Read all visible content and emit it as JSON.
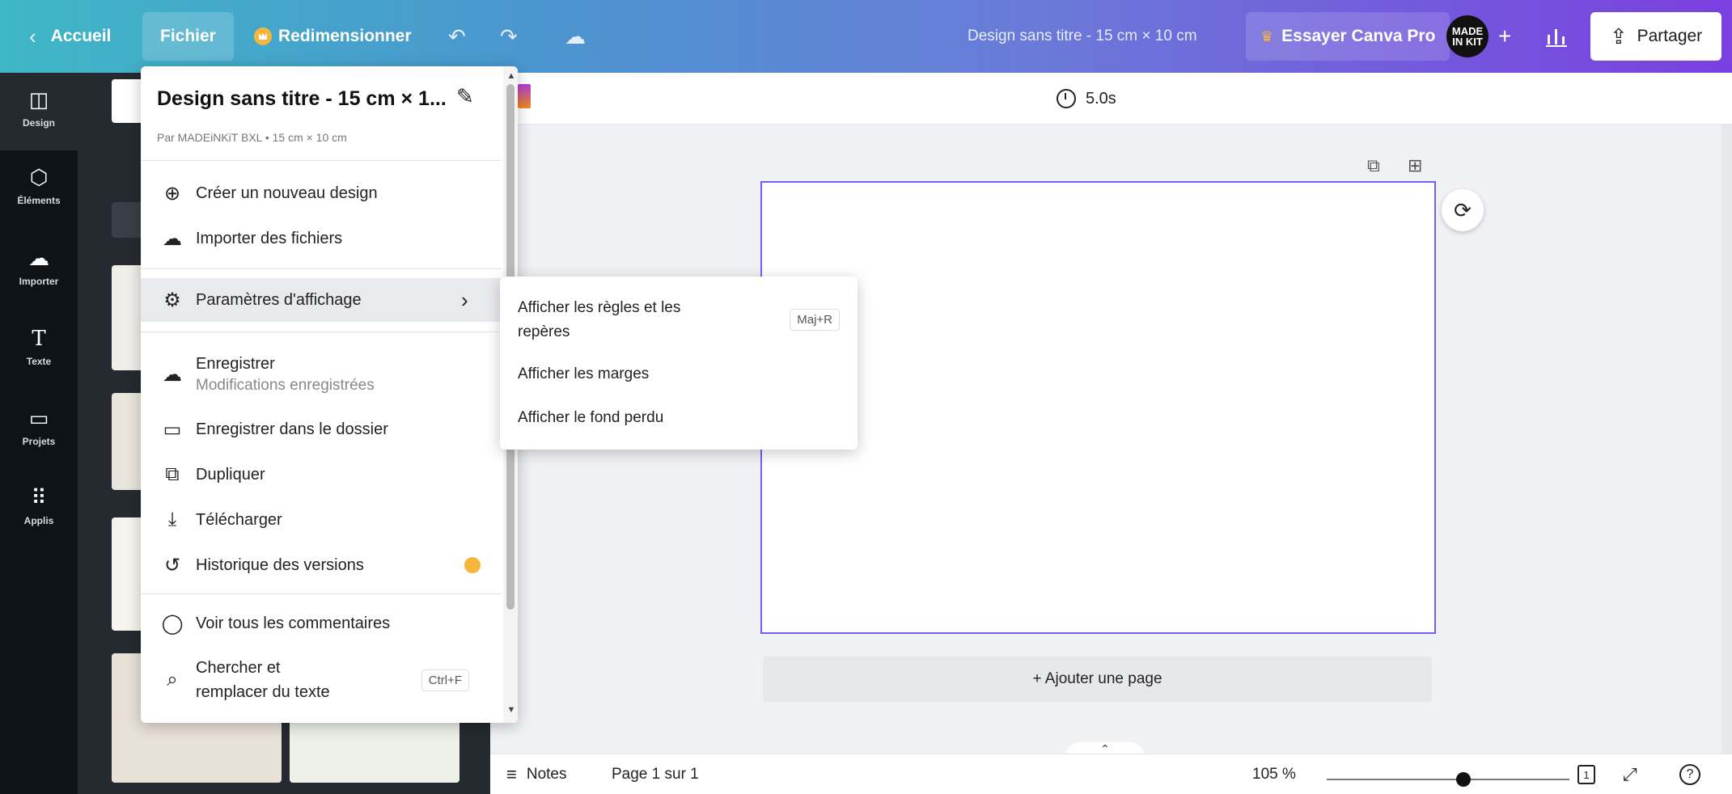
{
  "topbar": {
    "back_label": "Accueil",
    "file_label": "Fichier",
    "resize_label": "Redimensionner",
    "design_title": "Design sans titre - 15 cm × 10 cm",
    "try_pro_label": "Essayer Canva Pro",
    "avatar_text": "MADE IN KIT",
    "plus": "+",
    "share_label": "Partager"
  },
  "rail": {
    "items": [
      {
        "label": "Design"
      },
      {
        "label": "Éléments"
      },
      {
        "label": "Importer"
      },
      {
        "label": "Texte"
      },
      {
        "label": "Projets"
      },
      {
        "label": "Applis"
      }
    ]
  },
  "toolbar2": {
    "duration": "5.0s"
  },
  "menu": {
    "title": "Design sans titre - 15 cm × 1...",
    "subtitle": "Par MADEiNKiT BXL • 15 cm × 10 cm",
    "items": [
      {
        "label": "Créer un nouveau design"
      },
      {
        "label": "Importer des fichiers"
      },
      {
        "label": "Paramètres d'affichage"
      },
      {
        "label": "Enregistrer",
        "sub": "Modifications enregistrées"
      },
      {
        "label": "Enregistrer dans le dossier"
      },
      {
        "label": "Dupliquer"
      },
      {
        "label": "Télécharger"
      },
      {
        "label": "Historique des versions"
      },
      {
        "label": "Voir tous les commentaires"
      },
      {
        "label": "Chercher et",
        "label2": "remplacer du texte",
        "shortcut": "Ctrl+F"
      }
    ]
  },
  "submenu": {
    "items": [
      {
        "label": "Afficher les règles et les",
        "label2": "repères",
        "shortcut": "Maj+R"
      },
      {
        "label": "Afficher les marges"
      },
      {
        "label": "Afficher le fond perdu"
      }
    ]
  },
  "canvas": {
    "add_page_label": "+ Ajouter une page"
  },
  "footer": {
    "notes_label": "Notes",
    "page_label": "Page 1 sur 1",
    "zoom": "105 %",
    "page_count": "1",
    "help": "?"
  },
  "colors": {
    "accent": "#7a5af8",
    "rail_bg": "#0e1318",
    "premium": "#f6b63e"
  }
}
